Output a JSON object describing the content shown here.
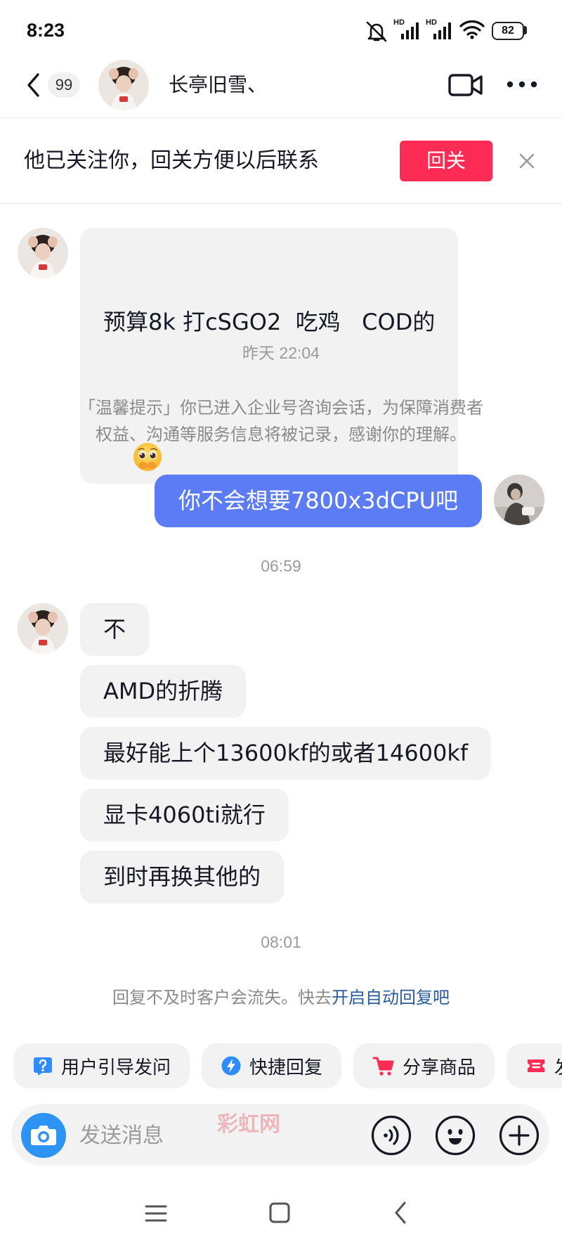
{
  "status_bar": {
    "time": "8:23",
    "network_label_1": "HD",
    "network_label_2": "HD",
    "battery_level": "82"
  },
  "header": {
    "unread_count": "99",
    "contact_name": "长亭旧雪、"
  },
  "follow_banner": {
    "text": "他已关注你，回关方便以后联系",
    "follow_back_label": "回关"
  },
  "chat": {
    "message_1": {
      "text": "预算8k 打cSGO2  吃鸡   COD的",
      "emoji": "pleading-face-icon"
    },
    "timestamp_1": "昨天 22:04",
    "notice_lines": [
      "「温馨提示」你已进入企业号咨询会话，为保障消费者",
      "权益、沟通等服务信息将被记录，感谢你的理解。"
    ],
    "message_2_outgoing": "你不会想要7800x3dCPU吧",
    "timestamp_2": "06:59",
    "message_group_3": [
      "不",
      "AMD的折腾",
      "最好能上个13600kf的或者14600kf",
      "显卡4060ti就行",
      "到时再换其他的"
    ],
    "timestamp_3": "08:01",
    "auto_reply_hint": {
      "text": "回复不及时客户会流失。快去",
      "link": "开启自动回复吧"
    }
  },
  "quick_actions": [
    {
      "label": "用户引导发问",
      "icon": "question-icon"
    },
    {
      "label": "快捷回复",
      "icon": "lightning-icon"
    },
    {
      "label": "分享商品",
      "icon": "cart-icon"
    },
    {
      "label": "发",
      "icon": "ticket-icon"
    }
  ],
  "composer": {
    "placeholder": "发送消息",
    "watermark": "彩虹网"
  },
  "icons": {
    "status": [
      "mute-icon",
      "signal-icon",
      "signal-icon",
      "wifi-icon",
      "battery-icon"
    ],
    "header": [
      "back-icon",
      "video-call-icon",
      "more-icon"
    ],
    "banner": [
      "close-icon"
    ],
    "composer": [
      "camera-icon",
      "voice-icon",
      "emoji-icon",
      "plus-icon"
    ],
    "nav": [
      "menu-icon",
      "home-icon",
      "back-nav-icon"
    ]
  },
  "colors": {
    "follow_button": "#fe2c55",
    "outgoing_bubble": "#5b7cf5",
    "incoming_bubble": "#f2f2f3",
    "link": "#2b5b9c",
    "camera_button": "#2d93f5"
  }
}
